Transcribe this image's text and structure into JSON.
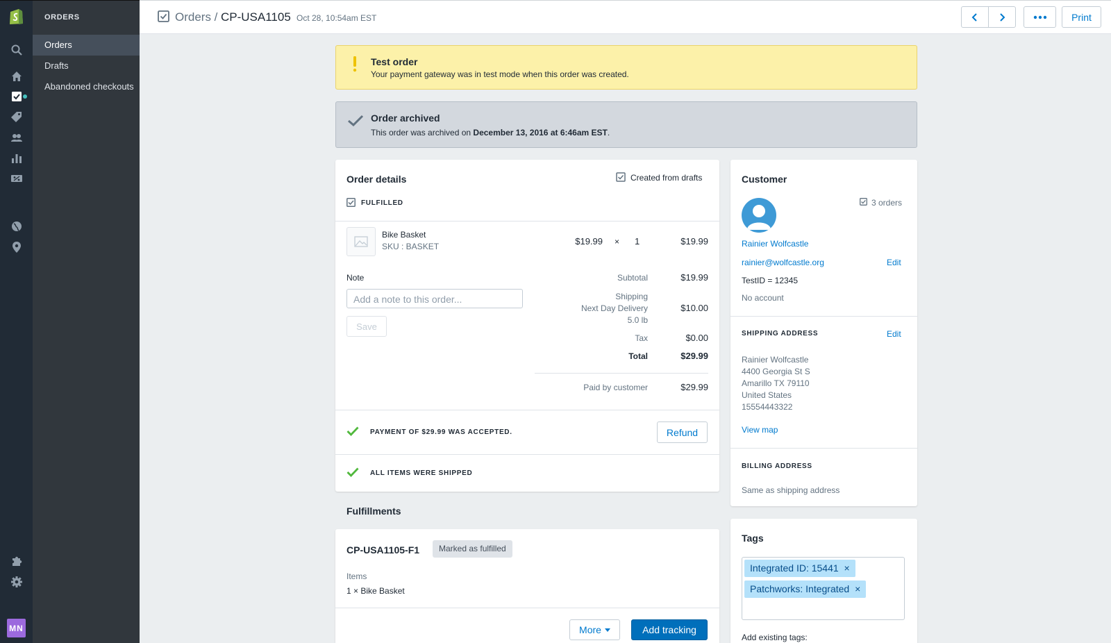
{
  "colors": {
    "accent": "#007ace",
    "success": "#50b83c",
    "warning": "#eec200",
    "rail": "#212b36",
    "subnav": "#31373d"
  },
  "rail": {
    "icons": [
      "shopify-logo-icon",
      "search-icon",
      "home-icon",
      "orders-icon",
      "products-tag-icon",
      "customers-icon",
      "analytics-icon",
      "discounts-icon",
      "online-store-globe-icon",
      "location-pin-icon",
      "apps-puzzle-icon",
      "settings-gear-icon"
    ],
    "user_initials": "MN"
  },
  "subnav": {
    "heading": "ORDERS",
    "items": [
      "Orders",
      "Drafts",
      "Abandoned checkouts"
    ]
  },
  "header": {
    "breadcrumb": "Orders /",
    "order_id": "CP-USA1105",
    "date": "Oct 28, 10:54am EST",
    "print_label": "Print"
  },
  "banners": {
    "test": {
      "title": "Test order",
      "text": "Your payment gateway was in test mode when this order was created."
    },
    "archived": {
      "title": "Order archived",
      "text_prefix": "This order was archived on ",
      "text_date": "December 13, 2016 at 6:46am EST",
      "text_suffix": "."
    }
  },
  "order": {
    "title": "Order details",
    "source": "Created from drafts",
    "status": "FULFILLED",
    "line_item": {
      "name": "Bike Basket",
      "sku": "SKU : BASKET",
      "price": "$19.99",
      "times": "×",
      "qty": "1",
      "total": "$19.99"
    },
    "note_label": "Note",
    "note_placeholder": "Add a note to this order...",
    "save_label": "Save",
    "subtotal_label": "Subtotal",
    "subtotal": "$19.99",
    "shipping_label": "Shipping",
    "shipping_method": "Next Day Delivery",
    "shipping_weight": "5.0 lb",
    "shipping": "$10.00",
    "tax_label": "Tax",
    "tax": "$0.00",
    "total_label": "Total",
    "total": "$29.99",
    "paid_label": "Paid by customer",
    "paid": "$29.99",
    "payment_status": "PAYMENT OF $29.99 WAS ACCEPTED.",
    "refund_label": "Refund",
    "shipped_status": "ALL ITEMS WERE SHIPPED"
  },
  "fulfillments": {
    "heading": "Fulfillments",
    "id": "CP-USA1105-F1",
    "badge": "Marked as fulfilled",
    "items_label": "Items",
    "items": "1 × Bike Basket",
    "more_label": "More",
    "add_tracking_label": "Add tracking"
  },
  "customer": {
    "title": "Customer",
    "orders_count": "3 orders",
    "name": "Rainier Wolfcastle",
    "email": "rainier@wolfcastle.org",
    "edit_label": "Edit",
    "test_id": "TestID = 12345",
    "account": "No account",
    "shipping_heading": "SHIPPING ADDRESS",
    "shipping_edit": "Edit",
    "address": [
      "Rainier Wolfcastle",
      "4400 Georgia St S",
      "Amarillo TX 79110",
      "United States",
      "15554443322"
    ],
    "view_map": "View map",
    "billing_heading": "BILLING ADDRESS",
    "billing_text": "Same as shipping address"
  },
  "tags": {
    "title": "Tags",
    "items": [
      "Integrated ID: 15441",
      "Patchworks: Integrated"
    ],
    "remove_glyph": "×",
    "add_existing": "Add existing tags:"
  }
}
